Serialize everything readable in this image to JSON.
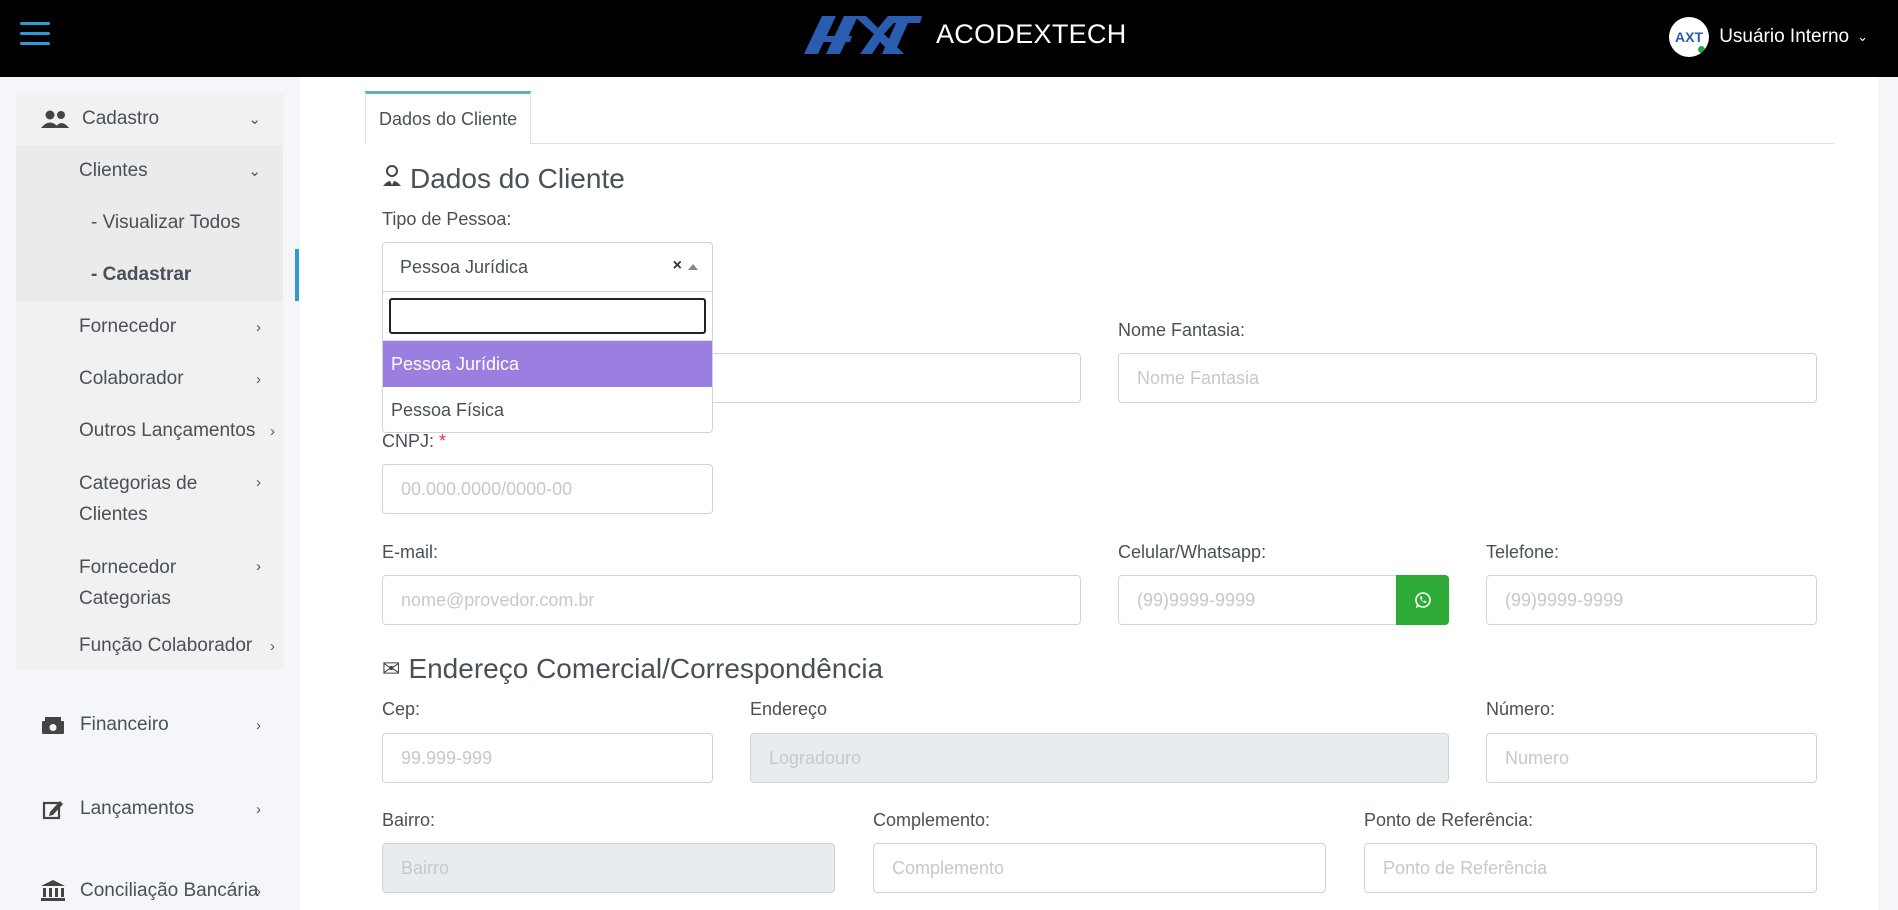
{
  "header": {
    "brand_name": "ACODEXTECH",
    "user_name": "Usuário Interno",
    "logo_text": "AXT"
  },
  "sidebar": {
    "cadastro": "Cadastro",
    "clientes": "Clientes",
    "visualizar_todos": "- Visualizar Todos",
    "cadastrar": "- Cadastrar",
    "fornecedor": "Fornecedor",
    "colaborador": "Colaborador",
    "outros_lancamentos": "Outros Lançamentos",
    "categorias_clientes_1": "Categorias de",
    "categorias_clientes_2": "Clientes",
    "fornecedor_categorias_1": "Fornecedor",
    "fornecedor_categorias_2": "Categorias",
    "funcao_colaborador": "Função Colaborador",
    "financeiro": "Financeiro",
    "lancamentos": "Lançamentos",
    "conciliacao": "Conciliação Bancária"
  },
  "tabs": {
    "dados_cliente": "Dados do Cliente"
  },
  "form": {
    "section_cliente": "Dados do Cliente",
    "tipo_pessoa_label": "Tipo de Pessoa:",
    "tipo_pessoa_value": "Pessoa Jurídica",
    "tipo_pessoa_options": [
      "Pessoa Jurídica",
      "Pessoa Física"
    ],
    "nome_fantasia_label": "Nome Fantasia:",
    "nome_fantasia_placeholder": "Nome Fantasia",
    "cnpj_label": "CNPJ:",
    "cnpj_required": "*",
    "cnpj_placeholder": "00.000.0000/0000-00",
    "email_label": "E-mail:",
    "email_placeholder": "nome@provedor.com.br",
    "celular_label": "Celular/Whatsapp:",
    "celular_placeholder": "(99)9999-9999",
    "telefone_label": "Telefone:",
    "telefone_placeholder": "(99)9999-9999",
    "section_endereco": "Endereço Comercial/Correspondência",
    "cep_label": "Cep:",
    "cep_placeholder": "99.999-999",
    "endereco_label": "Endereço",
    "endereco_placeholder": "Logradouro",
    "numero_label": "Número:",
    "numero_placeholder": "Numero",
    "bairro_label": "Bairro:",
    "bairro_placeholder": "Bairro",
    "complemento_label": "Complemento:",
    "complemento_placeholder": "Complemento",
    "referencia_label": "Ponto de Referência:",
    "referencia_placeholder": "Ponto de Referência"
  },
  "colors": {
    "accent": "#2e9bd6",
    "selected_option": "#9b7fe0",
    "whatsapp": "#2eab36",
    "tab_border": "#5ab8a8"
  }
}
